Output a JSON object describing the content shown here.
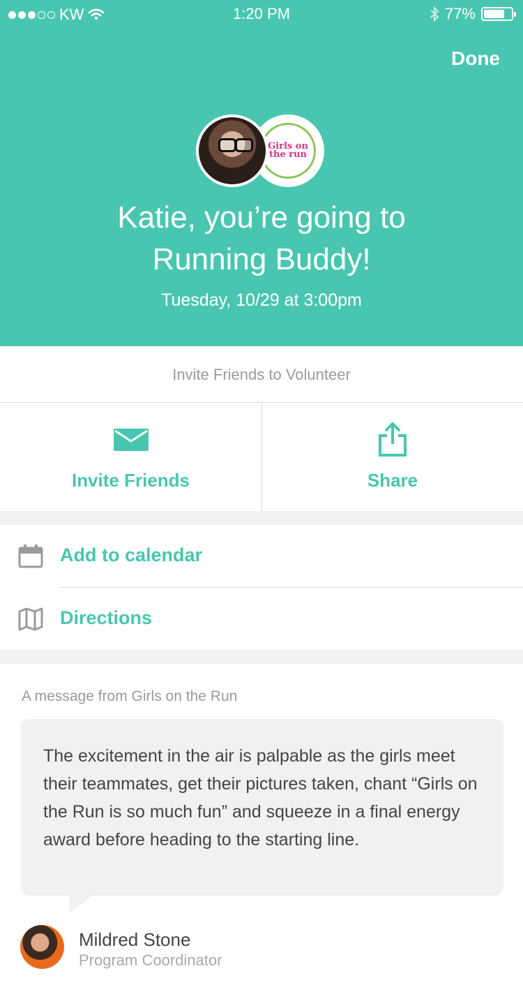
{
  "status_bar": {
    "carrier": "KW",
    "time": "1:20 PM",
    "battery_percent": "77%",
    "battery_level": 0.77
  },
  "header": {
    "done_label": "Done",
    "headline_line1": "Katie, you’re going to",
    "headline_line2": "Running Buddy!",
    "datetime": "Tuesday, 10/29 at 3:00pm",
    "org_logo_text": "Girls on the run",
    "background_color": "#49c6b0"
  },
  "invite": {
    "title": "Invite Friends to Volunteer",
    "invite_friends_label": "Invite Friends",
    "share_label": "Share"
  },
  "actions_list": {
    "calendar_label": "Add to calendar",
    "directions_label": "Directions"
  },
  "message": {
    "heading": "A message from Girls on the Run",
    "body": "The excitement in the air is palpable as the girls meet their teammates, get their pictures taken, chant “Girls on the Run is so much fun” and squeeze in a final energy award before heading to the starting line.",
    "author_name": "Mildred Stone",
    "author_role": "Program Coordinator"
  },
  "accent_color": "#49c6b0"
}
